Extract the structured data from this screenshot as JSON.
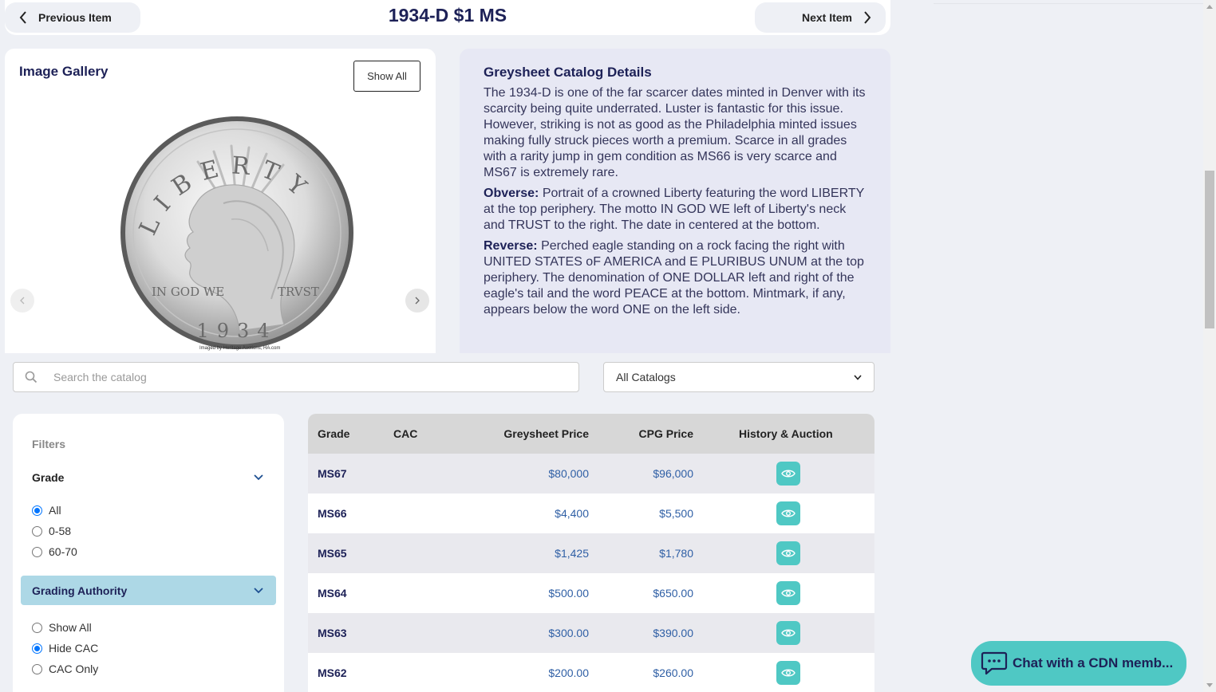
{
  "nav": {
    "previous_label": "Previous Item",
    "next_label": "Next Item",
    "item_title": "1934-D $1 MS"
  },
  "gallery": {
    "title": "Image Gallery",
    "show_all_label": "Show All",
    "coin_legend_top": "LIBERTY",
    "coin_motto_left": "IN GOD WE",
    "coin_motto_right": "TRVST",
    "coin_date": "1934",
    "image_credit": "Imaged by Heritage Auctions, HA.com"
  },
  "details": {
    "title": "Greysheet Catalog Details",
    "description": "The 1934-D is one of the far scarcer dates minted in Denver with its scarcity being quite underrated. Luster is fantastic for this issue. However, striking is not as good as the Philadelphia minted issues making fully struck pieces worth a premium. Scarce in all grades with a rarity jump in gem condition as MS66 is very scarce and MS67 is extremely rare.",
    "obverse_label": "Obverse:",
    "obverse_text": "Portrait of a crowned Liberty featuring the word LIBERTY at the top periphery. The motto IN GOD WE left of Liberty's neck and TRUST to the right. The date in centered at the bottom.",
    "reverse_label": "Reverse:",
    "reverse_text": "Perched eagle standing on a rock facing the right with UNITED STATES oF AMERICA and E PLURIBUS UNUM at the top periphery. The denomination of ONE DOLLAR left and right of the eagle's tail and the word PEACE at the bottom. Mintmark, if any, appears below the word ONE on the left side."
  },
  "search": {
    "placeholder": "Search the catalog",
    "catalog_selected": "All Catalogs"
  },
  "filters": {
    "title": "Filters",
    "grade_section": "Grade",
    "grade_options": [
      "All",
      "0-58",
      "60-70"
    ],
    "grade_selected": "All",
    "authority_section": "Grading Authority",
    "authority_options": [
      "Show All",
      "Hide CAC",
      "CAC Only"
    ],
    "authority_selected": "Hide CAC"
  },
  "table": {
    "headers": {
      "grade": "Grade",
      "cac": "CAC",
      "greysheet": "Greysheet Price",
      "cpg": "CPG Price",
      "history": "History & Auction"
    },
    "rows": [
      {
        "grade": "MS67",
        "cac": "",
        "greysheet": "$80,000",
        "cpg": "$96,000"
      },
      {
        "grade": "MS66",
        "cac": "",
        "greysheet": "$4,400",
        "cpg": "$5,500"
      },
      {
        "grade": "MS65",
        "cac": "",
        "greysheet": "$1,425",
        "cpg": "$1,780"
      },
      {
        "grade": "MS64",
        "cac": "",
        "greysheet": "$500.00",
        "cpg": "$650.00"
      },
      {
        "grade": "MS63",
        "cac": "",
        "greysheet": "$300.00",
        "cpg": "$390.00"
      },
      {
        "grade": "MS62",
        "cac": "",
        "greysheet": "$200.00",
        "cpg": "$260.00"
      }
    ]
  },
  "chat": {
    "label": "Chat with a CDN memb..."
  },
  "colors": {
    "title_navy": "#1d2157",
    "teal_accent": "#4fc8c4",
    "price_blue": "#2f5fa5",
    "section_highlight": "#add8e6",
    "radio_blue": "#0075ff"
  },
  "icons": {
    "prev": "chevron-left-icon",
    "next": "chevron-right-icon",
    "search": "search-icon",
    "select": "chevron-down-icon",
    "history": "eye-icon",
    "chat": "chat-bubble-icon"
  }
}
